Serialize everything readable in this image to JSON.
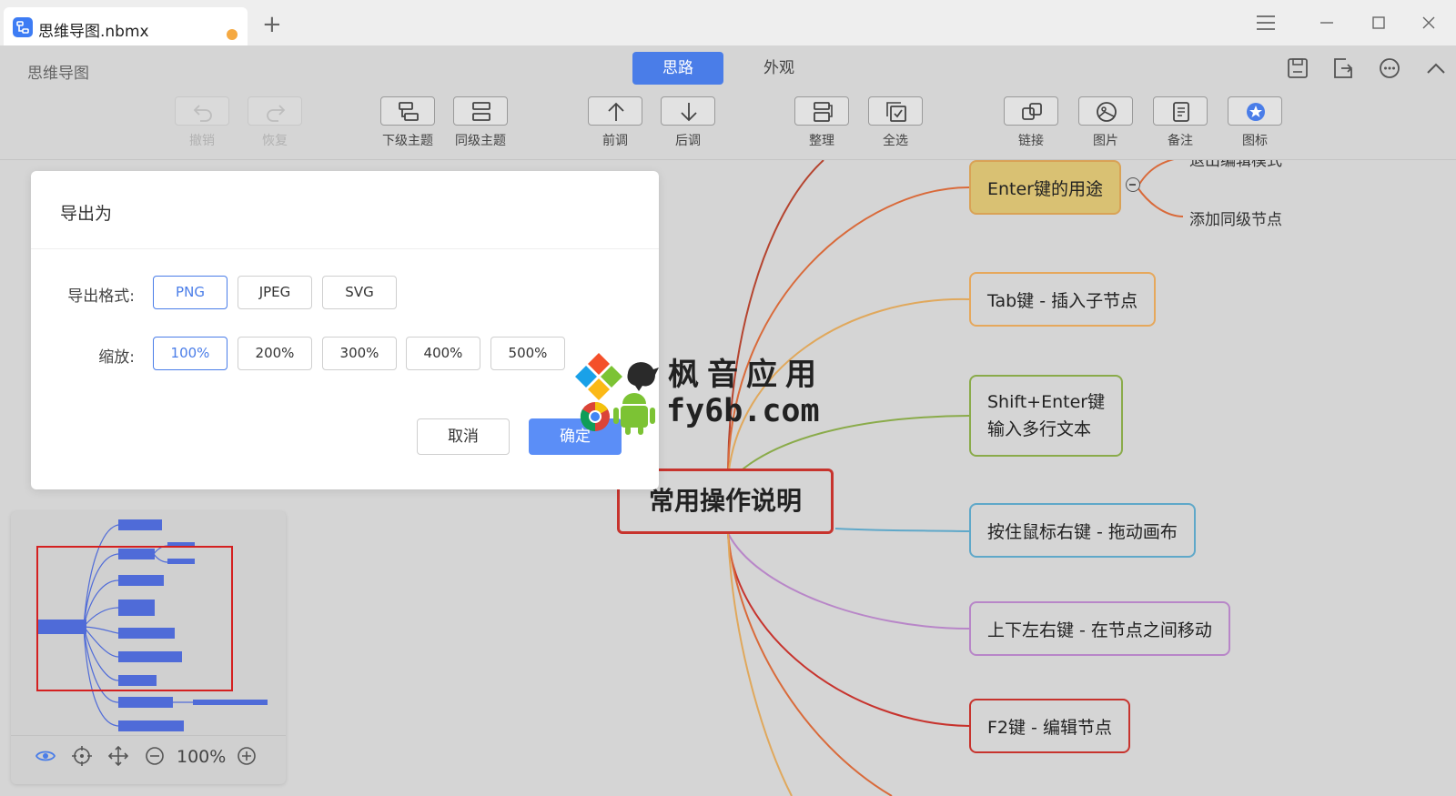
{
  "titlebar": {
    "tab_title": "思维导图.nbmx",
    "new_tab_symbol": "+"
  },
  "toolbar": {
    "app_name": "思维导图",
    "mode_tabs": [
      {
        "label": "思路",
        "active": true
      },
      {
        "label": "外观",
        "active": false
      }
    ],
    "tools": [
      {
        "label": "撤销",
        "icon": "undo-icon",
        "enabled": false
      },
      {
        "label": "恢复",
        "icon": "redo-icon",
        "enabled": false
      },
      {
        "label": "下级主题",
        "icon": "child-topic-icon",
        "enabled": true
      },
      {
        "label": "同级主题",
        "icon": "sibling-topic-icon",
        "enabled": true
      },
      {
        "label": "前调",
        "icon": "move-up-icon",
        "enabled": true
      },
      {
        "label": "后调",
        "icon": "move-down-icon",
        "enabled": true
      },
      {
        "label": "整理",
        "icon": "arrange-icon",
        "enabled": true
      },
      {
        "label": "全选",
        "icon": "select-all-icon",
        "enabled": true
      },
      {
        "label": "链接",
        "icon": "link-icon",
        "enabled": true
      },
      {
        "label": "图片",
        "icon": "image-icon",
        "enabled": true
      },
      {
        "label": "备注",
        "icon": "note-icon",
        "enabled": true
      },
      {
        "label": "图标",
        "icon": "emoji-icon",
        "enabled": true
      }
    ]
  },
  "mindmap": {
    "root": "常用操作说明",
    "enter_node": "Enter键的用途",
    "enter_children": [
      "退出编辑模式",
      "添加同级节点"
    ],
    "tab_node": "Tab键 - 插入子节点",
    "shift_enter_line1": "Shift+Enter键",
    "shift_enter_line2": "输入多行文本",
    "right_drag_node": "按住鼠标右键 - 拖动画布",
    "arrow_keys_node": "上下左右键 - 在节点之间移动",
    "f2_node": "F2键 - 编辑节点",
    "colors": {
      "root": "#c7332d",
      "enter": "#d9c173",
      "tab": "#e6a85c",
      "shift_enter": "#8aab4a",
      "right_drag": "#5fa8c9",
      "arrow_keys": "#b886c8",
      "f2": "#c7332d"
    }
  },
  "minimap": {
    "zoom": "100%"
  },
  "dialog": {
    "title": "导出为",
    "format_label": "导出格式:",
    "formats": [
      "PNG",
      "JPEG",
      "SVG"
    ],
    "selected_format": "PNG",
    "scale_label": "缩放:",
    "scales": [
      "100%",
      "200%",
      "300%",
      "400%",
      "500%"
    ],
    "selected_scale": "100%",
    "cancel": "取消",
    "ok": "确定"
  },
  "watermark": {
    "cn": "枫音应用",
    "en": "fy6b.com"
  },
  "accent_color": "#4a7de8"
}
